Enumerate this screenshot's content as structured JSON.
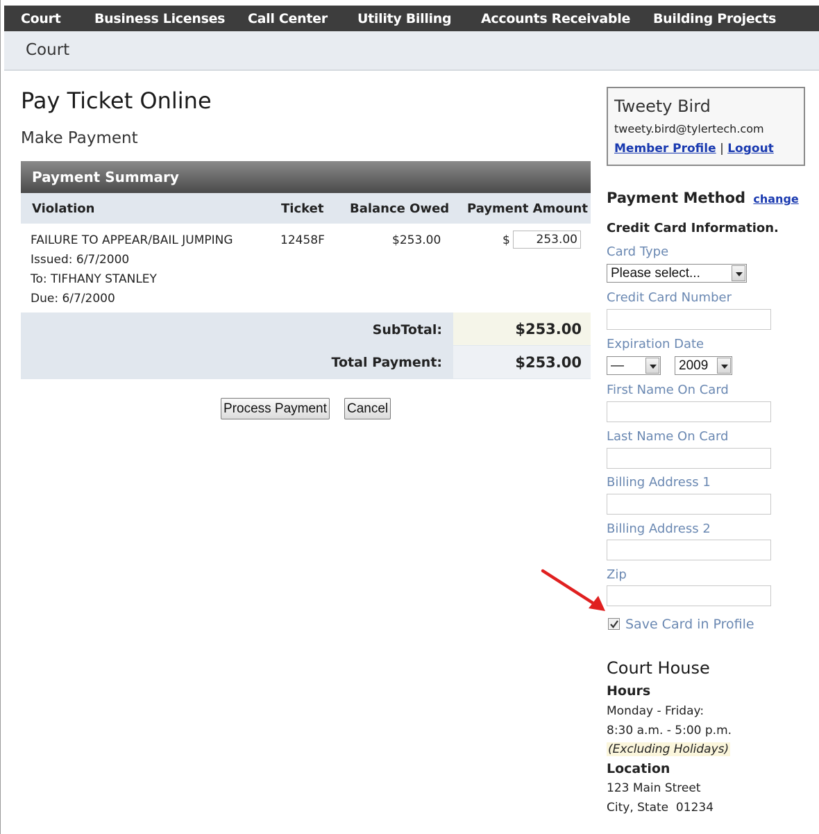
{
  "nav": {
    "items": [
      "Court",
      "Business Licenses",
      "Call Center",
      "Utility Billing",
      "Accounts Receivable",
      "Building Projects"
    ]
  },
  "breadcrumb": "Court",
  "page": {
    "title": "Pay Ticket Online",
    "subtitle": "Make Payment"
  },
  "summary": {
    "heading": "Payment Summary",
    "columns": [
      "Violation",
      "Ticket",
      "Balance Owed",
      "Payment Amount"
    ],
    "row": {
      "violation": "FAILURE TO APPEAR/BAIL JUMPING",
      "issued": "Issued: 6/7/2000",
      "to": "To: TIFHANY STANLEY",
      "due": "Due: 6/7/2000",
      "ticket": "12458F",
      "balance": "$253.00",
      "currency": "$",
      "amount": "253.00"
    },
    "subtotal_label": "SubTotal:",
    "subtotal_value": "$253.00",
    "total_label": "Total Payment:",
    "total_value": "$253.00"
  },
  "buttons": {
    "process": "Process Payment",
    "cancel": "Cancel"
  },
  "user": {
    "name": "Tweety Bird",
    "email": "tweety.bird@tylertech.com",
    "profile_link": "Member Profile",
    "separator": "|",
    "logout_link": "Logout"
  },
  "payment_method": {
    "title": "Payment Method",
    "change_link": "change",
    "section": "Credit Card Information.",
    "card_type_label": "Card Type",
    "card_type_value": "Please select...",
    "card_number_label": "Credit Card Number",
    "expiration_label": "Expiration Date",
    "exp_month_value": "—",
    "exp_year_value": "2009",
    "first_name_label": "First Name On Card",
    "last_name_label": "Last Name On Card",
    "address1_label": "Billing Address 1",
    "address2_label": "Billing Address 2",
    "zip_label": "Zip",
    "save_card_label": "Save Card in Profile",
    "save_card_checked": true
  },
  "court_house": {
    "title": "Court House",
    "hours_label": "Hours",
    "days": "Monday - Friday:",
    "time": "8:30 a.m. - 5:00 p.m.",
    "note": "(Excluding Holidays)",
    "location_label": "Location",
    "street": "123 Main Street",
    "city": "City, State  01234"
  },
  "colors": {
    "nav_bg": "#3d3d3d",
    "label_blue": "#6a88b2",
    "link_blue": "#1a3ab0",
    "annotation_arrow": "#e02020"
  }
}
